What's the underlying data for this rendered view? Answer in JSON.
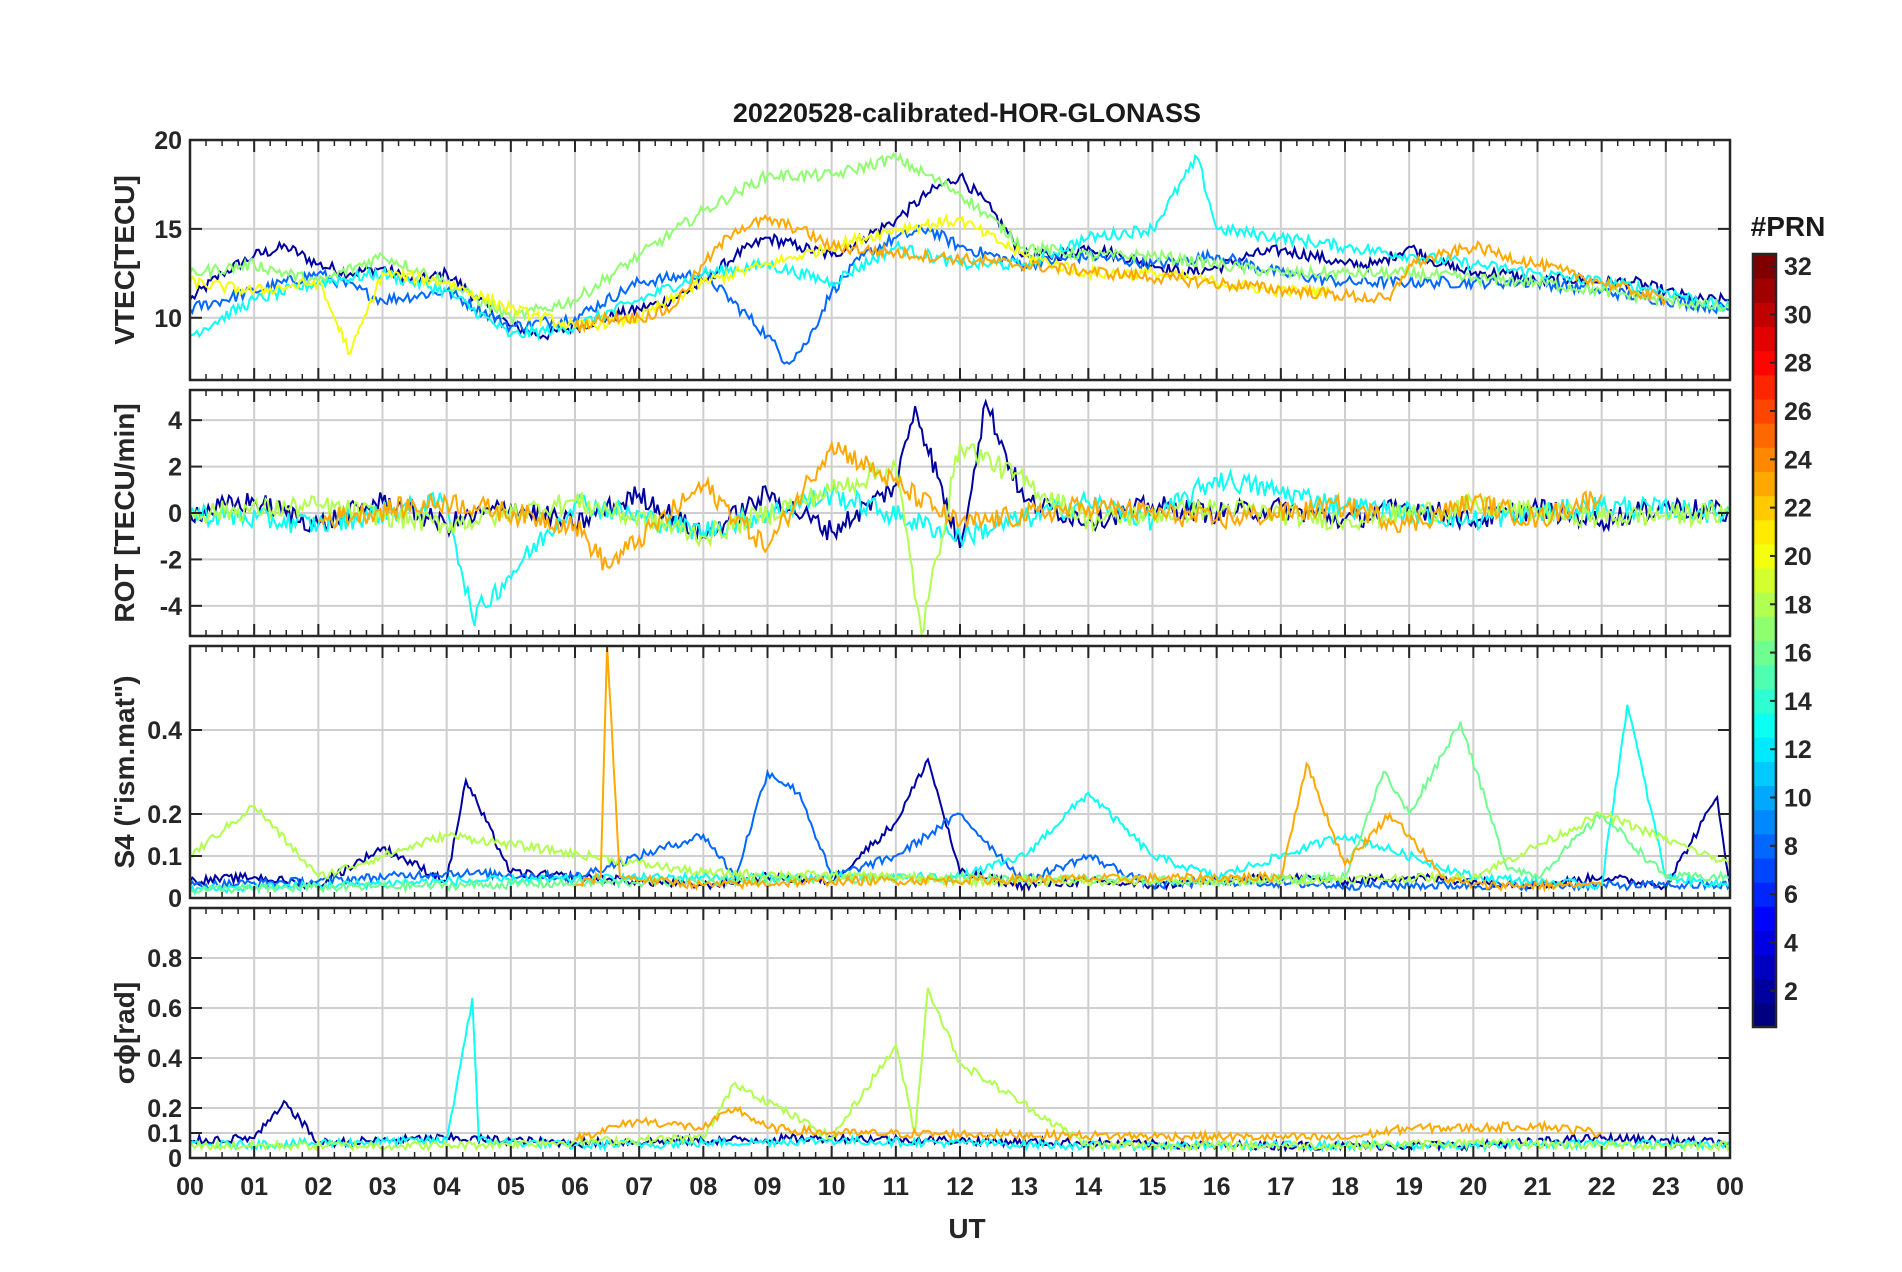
{
  "chart_data": {
    "type": "line",
    "title": "20220528-calibrated-HOR-GLONASS",
    "xlabel": "UT",
    "x_tick_labels": [
      "00",
      "01",
      "02",
      "03",
      "04",
      "05",
      "06",
      "07",
      "08",
      "09",
      "10",
      "11",
      "12",
      "13",
      "14",
      "15",
      "16",
      "17",
      "18",
      "19",
      "20",
      "21",
      "22",
      "23",
      "00"
    ],
    "xlim": [
      0,
      24
    ],
    "grid": true,
    "colorbar": {
      "title": "#PRN",
      "tick_labels": [
        "2",
        "4",
        "6",
        "8",
        "10",
        "12",
        "14",
        "16",
        "18",
        "20",
        "22",
        "24",
        "26",
        "28",
        "30",
        "32"
      ],
      "range": [
        1,
        32
      ],
      "colormap": "jet"
    },
    "panels": [
      {
        "ylabel": "VTEC[TECU]",
        "ylim": [
          6.5,
          20
        ],
        "y_ticks": [
          10,
          15,
          20
        ],
        "y_tick_labels": [
          "10",
          "15",
          "20"
        ],
        "series": [
          {
            "prn": 2,
            "x": [
              0,
              0.5,
              1,
              1.5,
              2,
              2.5,
              3,
              3.5,
              4,
              4.5,
              5,
              5.5,
              6,
              6.5,
              7,
              7.5,
              8,
              8.5,
              9,
              9.5,
              10,
              10.5,
              11,
              11.5,
              12,
              12.5,
              13,
              13.5,
              14,
              14.5,
              15,
              15.5,
              16,
              16.5,
              17,
              17.5,
              18,
              18.5,
              19,
              19.5,
              20,
              20.5,
              21,
              21.5,
              22,
              22.5,
              23,
              23.5,
              24
            ],
            "y": [
              11,
              12.5,
              13.5,
              14,
              13,
              12.5,
              12.8,
              12,
              12.5,
              11,
              9.5,
              9,
              9.5,
              10,
              10.5,
              11,
              12,
              13.5,
              14.5,
              14,
              13.5,
              14.5,
              15.5,
              17,
              18,
              16,
              13.5,
              13.5,
              14,
              13.5,
              13,
              12.5,
              12.8,
              13.5,
              13.8,
              13.5,
              13,
              13,
              14,
              13,
              12.5,
              12.5,
              12,
              12.2,
              12,
              12,
              11.5,
              11,
              11
            ]
          },
          {
            "prn": 8,
            "x": [
              0,
              1,
              2,
              3,
              4,
              5,
              6,
              7,
              8,
              9,
              9.3,
              9.6,
              10,
              10.5,
              11,
              11.5,
              12,
              13,
              14,
              15,
              16,
              17,
              18,
              19,
              20,
              21,
              22,
              23,
              24
            ],
            "y": [
              10.5,
              11.5,
              12.5,
              11,
              11.5,
              9.5,
              10,
              12,
              12.5,
              9,
              7.5,
              8.5,
              11.5,
              13.5,
              14.5,
              15,
              14,
              13,
              13.5,
              13,
              13.5,
              12.5,
              12,
              12,
              12,
              12,
              11.5,
              11,
              10.5
            ]
          },
          {
            "prn": 13,
            "x": [
              0,
              1,
              2,
              3,
              4,
              5,
              6,
              7,
              8,
              9,
              10,
              11,
              12,
              13,
              14,
              15,
              15.7,
              16,
              17,
              18,
              19,
              20,
              21,
              22,
              23,
              24
            ],
            "y": [
              9,
              11,
              12,
              12.5,
              11.5,
              9,
              9.5,
              11,
              12.5,
              13,
              12,
              14,
              13,
              13,
              14.5,
              15,
              19,
              15,
              14.5,
              14,
              13.5,
              13,
              12.5,
              12,
              11.5,
              10.5
            ]
          },
          {
            "prn": 17,
            "x": [
              0,
              1,
              2,
              3,
              4,
              5,
              6,
              7,
              8,
              9,
              10,
              11,
              12,
              13,
              14,
              15,
              16,
              17,
              18,
              19,
              20,
              21,
              22,
              23,
              24
            ],
            "y": [
              12.5,
              13,
              12,
              13.5,
              12,
              10,
              11,
              13.5,
              16,
              18,
              18,
              19,
              17,
              14,
              13.5,
              13.5,
              13,
              12.5,
              12.5,
              12.5,
              12.2,
              12,
              11.5,
              11,
              10.5
            ]
          },
          {
            "prn": 20,
            "x": [
              0,
              1,
              2,
              2.5,
              3,
              4,
              5,
              6,
              7,
              8,
              9,
              10,
              11,
              12,
              13,
              14,
              15,
              16,
              17,
              17.8
            ],
            "y": [
              12,
              11.5,
              12,
              8,
              12.5,
              12,
              10.5,
              9.5,
              10,
              12,
              13,
              14,
              15,
              15.5,
              13.5,
              12.5,
              12.5,
              12,
              11.5,
              11.5
            ]
          },
          {
            "prn": 23,
            "x": [
              6,
              6.5,
              7,
              7.5,
              8,
              8.5,
              9,
              9.5,
              10,
              18.7,
              19,
              19.5,
              20,
              20.5,
              21,
              21.5,
              22,
              22.5,
              23
            ],
            "y": [
              9.5,
              10,
              10,
              10.5,
              13,
              15,
              15.5,
              15,
              14,
              11,
              13,
              13.5,
              14,
              13.5,
              13,
              12.5,
              12,
              11.5,
              11
            ]
          }
        ]
      },
      {
        "ylabel": "ROT [TECU/min]",
        "ylim": [
          -5.3,
          5.3
        ],
        "y_ticks": [
          -4,
          -2,
          0,
          2,
          4
        ],
        "y_tick_labels": [
          "-4",
          "-2",
          "0",
          "2",
          "4"
        ],
        "series": [
          {
            "prn": 2,
            "x": [
              0,
              1,
              2,
              3,
              4,
              5,
              6,
              7,
              8,
              9,
              10,
              11,
              11.3,
              12,
              12.4,
              13,
              14,
              15,
              16,
              17,
              18,
              19,
              20,
              21,
              22,
              23,
              24
            ],
            "y": [
              0,
              0.5,
              -0.5,
              0.5,
              -0.5,
              0.3,
              -0.5,
              0.8,
              -1,
              0.8,
              -0.8,
              1.2,
              4.6,
              -1.5,
              4.8,
              0.5,
              -0.3,
              0.3,
              0,
              0.2,
              -0.3,
              0.3,
              -0.3,
              0.2,
              -0.3,
              0.3,
              0
            ]
          },
          {
            "prn": 13,
            "x": [
              0,
              2,
              4,
              4.4,
              6,
              8,
              10,
              12,
              14,
              15,
              16,
              18,
              20,
              22,
              24
            ],
            "y": [
              0,
              -0.5,
              0.5,
              -4.5,
              0.5,
              -0.8,
              0.8,
              -1,
              0.5,
              -0.3,
              1.5,
              0.3,
              -0.3,
              0.3,
              0
            ]
          },
          {
            "prn": 18,
            "x": [
              0,
              2,
              4,
              6,
              8,
              10,
              11,
              11.4,
              12,
              14,
              16,
              18,
              20,
              22,
              24
            ],
            "y": [
              0,
              0.3,
              -0.5,
              0.5,
              -1,
              1,
              2,
              -5.2,
              3,
              -0.3,
              0.2,
              -0.3,
              0.3,
              -0.2,
              0
            ]
          },
          {
            "prn": 23,
            "x": [
              2,
              4,
              6,
              6.5,
              8,
              9,
              10,
              12,
              14,
              16,
              18,
              19,
              20,
              21,
              22
            ],
            "y": [
              -0.3,
              0.5,
              -0.5,
              -2.3,
              1.2,
              -1.5,
              3,
              -0.5,
              0.3,
              -0.3,
              0.3,
              -0.5,
              0.5,
              -0.3,
              0.8
            ]
          }
        ]
      },
      {
        "ylabel": "S4 (\"ism.mat\")",
        "ylim": [
          0,
          0.6
        ],
        "y_ticks": [
          0,
          0.1,
          0.2,
          0.4
        ],
        "y_tick_labels": [
          "0",
          "0.1",
          "0.2",
          "0.4"
        ],
        "series": [
          {
            "prn": 2,
            "x": [
              0,
              1,
              2,
              3,
              4,
              4.3,
              5,
              6,
              7,
              8,
              9,
              10,
              11,
              11.5,
              12,
              13,
              14,
              15,
              16,
              17,
              18,
              19,
              20,
              21,
              22,
              23,
              23.8,
              24
            ],
            "y": [
              0.04,
              0.05,
              0.03,
              0.12,
              0.04,
              0.28,
              0.06,
              0.05,
              0.04,
              0.03,
              0.05,
              0.04,
              0.18,
              0.33,
              0.06,
              0.03,
              0.04,
              0.03,
              0.04,
              0.05,
              0.04,
              0.05,
              0.04,
              0.03,
              0.05,
              0.03,
              0.24,
              0.03
            ]
          },
          {
            "prn": 8,
            "x": [
              0,
              2,
              4,
              6,
              8,
              8.5,
              9,
              9.5,
              10,
              11,
              12,
              13,
              14,
              15,
              16,
              18,
              20,
              22,
              24
            ],
            "y": [
              0.03,
              0.04,
              0.06,
              0.05,
              0.15,
              0.05,
              0.3,
              0.25,
              0.05,
              0.1,
              0.2,
              0.04,
              0.1,
              0.03,
              0.04,
              0.03,
              0.03,
              0.03,
              0.03
            ]
          },
          {
            "prn": 13,
            "x": [
              0,
              4,
              8,
              12,
              13,
              14,
              15,
              16,
              18,
              20,
              22,
              22.4,
              23,
              24
            ],
            "y": [
              0.02,
              0.04,
              0.05,
              0.05,
              0.1,
              0.25,
              0.1,
              0.05,
              0.15,
              0.05,
              0.03,
              0.46,
              0.05,
              0.03
            ]
          },
          {
            "prn": 16,
            "x": [
              0,
              4,
              8,
              12,
              16,
              18,
              18.6,
              19,
              19.8,
              20.5,
              21,
              22,
              23,
              24
            ],
            "y": [
              0.02,
              0.03,
              0.04,
              0.05,
              0.04,
              0.05,
              0.3,
              0.2,
              0.42,
              0.08,
              0.05,
              0.2,
              0.05,
              0.05
            ]
          },
          {
            "prn": 18,
            "x": [
              0,
              1,
              2,
              3,
              4,
              8,
              11,
              12,
              16,
              20,
              22,
              24
            ],
            "y": [
              0.1,
              0.22,
              0.05,
              0.1,
              0.15,
              0.06,
              0.05,
              0.04,
              0.04,
              0.05,
              0.2,
              0.08
            ]
          },
          {
            "prn": 23,
            "x": [
              6,
              6.4,
              6.5,
              6.7,
              8,
              10,
              17,
              17.4,
              18,
              18.7,
              19,
              19.5,
              20,
              21,
              22
            ],
            "y": [
              0.03,
              0.05,
              0.6,
              0.05,
              0.03,
              0.04,
              0.05,
              0.32,
              0.08,
              0.2,
              0.15,
              0.05,
              0.03,
              0.03,
              0.03
            ]
          }
        ]
      },
      {
        "ylabel": "σϕ[rad]",
        "ylim": [
          0,
          1
        ],
        "y_ticks": [
          0,
          0.1,
          0.2,
          0.4,
          0.6,
          0.8
        ],
        "y_tick_labels": [
          "0",
          "0.1",
          "0.2",
          "0.4",
          "0.6",
          "0.8"
        ],
        "series": [
          {
            "prn": 2,
            "x": [
              0,
              1,
              1.5,
              2,
              4,
              6,
              8,
              10,
              12,
              14,
              16,
              18,
              20,
              22,
              24
            ],
            "y": [
              0.07,
              0.08,
              0.22,
              0.06,
              0.08,
              0.06,
              0.07,
              0.08,
              0.07,
              0.06,
              0.05,
              0.05,
              0.05,
              0.08,
              0.06
            ]
          },
          {
            "prn": 13,
            "x": [
              0,
              2,
              4,
              4.4,
              4.5,
              6,
              8,
              10,
              12,
              14,
              16,
              18,
              20,
              22,
              24
            ],
            "y": [
              0.05,
              0.06,
              0.07,
              0.64,
              0.07,
              0.05,
              0.06,
              0.07,
              0.06,
              0.05,
              0.05,
              0.05,
              0.05,
              0.06,
              0.05
            ]
          },
          {
            "prn": 18,
            "x": [
              0,
              4,
              8,
              8.5,
              10,
              11,
              11.3,
              11.5,
              12,
              14,
              16,
              18,
              20,
              22,
              24
            ],
            "y": [
              0.05,
              0.05,
              0.08,
              0.3,
              0.08,
              0.45,
              0.1,
              0.68,
              0.38,
              0.05,
              0.05,
              0.05,
              0.06,
              0.05,
              0.05
            ]
          },
          {
            "prn": 23,
            "x": [
              6,
              7,
              8,
              8.5,
              9,
              10,
              18,
              19,
              20,
              21,
              22
            ],
            "y": [
              0.08,
              0.15,
              0.12,
              0.2,
              0.12,
              0.1,
              0.08,
              0.12,
              0.12,
              0.13,
              0.1
            ]
          }
        ]
      }
    ]
  }
}
